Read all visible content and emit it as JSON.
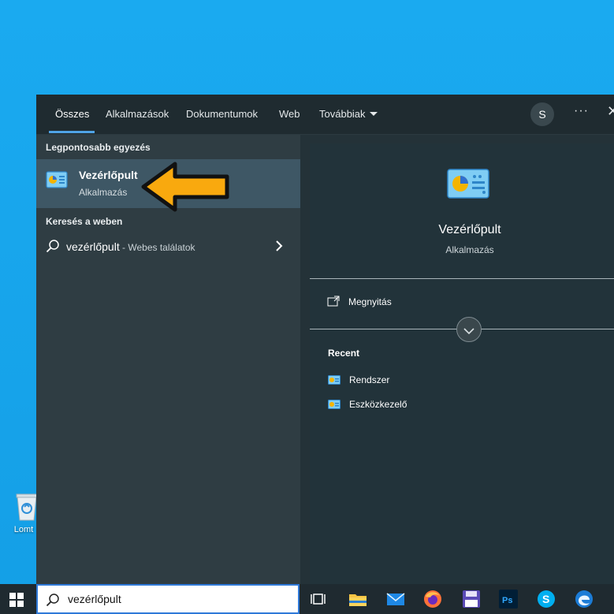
{
  "desktop": {
    "recycle_bin_label": "Lomt"
  },
  "tabs": [
    {
      "label": "Összes",
      "active": true
    },
    {
      "label": "Alkalmazások",
      "active": false
    },
    {
      "label": "Dokumentumok",
      "active": false
    },
    {
      "label": "Web",
      "active": false
    },
    {
      "label": "Továbbiak",
      "active": false
    }
  ],
  "header": {
    "avatar_initial": "S",
    "more_glyph": "···",
    "close_glyph": "✕"
  },
  "left": {
    "best_match_label": "Legpontosabb egyezés",
    "best_match": {
      "title": "Vezérlőpult",
      "subtitle": "Alkalmazás"
    },
    "web_label": "Keresés a weben",
    "web_result": {
      "query": "vezérlőpult",
      "suffix": " - Webes találatok"
    }
  },
  "right": {
    "title": "Vezérlőpult",
    "subtitle": "Alkalmazás",
    "open_label": "Megnyitás",
    "recent_title": "Recent",
    "recent_items": [
      {
        "label": "Rendszer"
      },
      {
        "label": "Eszközkezelő"
      }
    ]
  },
  "taskbar": {
    "search_value": "vezérlőpult"
  },
  "colors": {
    "accent": "#4fa3e6",
    "arrow": "#f9a90e",
    "desktop": "#16a6ec"
  },
  "icons": [
    "windows-start-icon",
    "search-icon",
    "task-view-icon",
    "file-explorer-icon",
    "mail-icon",
    "firefox-icon",
    "save-icon",
    "photoshop-icon",
    "skype-icon",
    "edge-icon",
    "control-panel-icon",
    "chevron-right-icon",
    "chevron-down-icon",
    "open-icon",
    "recycle-bin-icon"
  ]
}
